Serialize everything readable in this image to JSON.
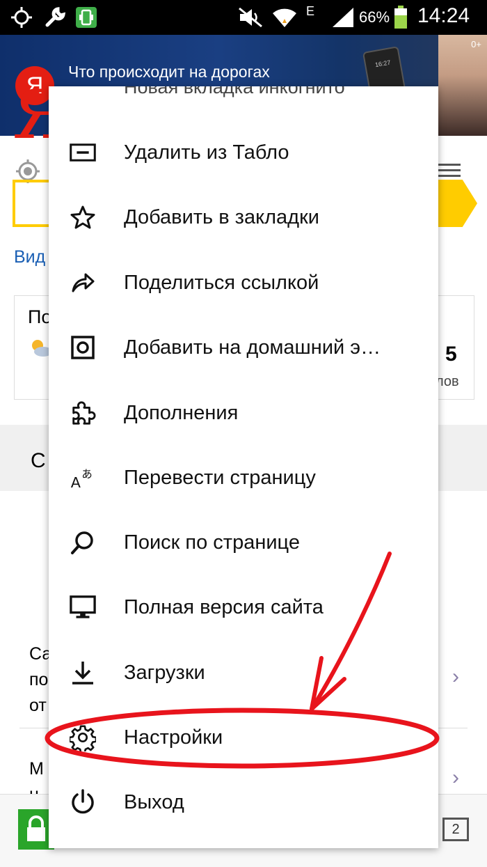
{
  "status_bar": {
    "battery": "66%",
    "time": "14:24",
    "network": "E"
  },
  "banner": {
    "logo": "Я",
    "headline": "Что происходит на дорогах",
    "phone_time": "16:27",
    "corner": "0+"
  },
  "background_page": {
    "logo": "Я",
    "link_fragment": "Вид",
    "weather_title_fragment": "По",
    "weather_value": "5",
    "weather_unit_fragment": "лов",
    "section_fragment": "С",
    "row1_lines": [
      "Са",
      "по",
      "от"
    ],
    "row2_lines": [
      "М",
      "н"
    ],
    "tab_count": "2"
  },
  "menu": {
    "top_partial": "Новая вкладка инкогнито",
    "items": [
      {
        "label": "Удалить из Табло",
        "icon": "remove-from-tablo-icon"
      },
      {
        "label": "Добавить в закладки",
        "icon": "star-icon"
      },
      {
        "label": "Поделиться ссылкой",
        "icon": "share-icon"
      },
      {
        "label": "Добавить на домашний экран",
        "icon": "home-screen-icon"
      },
      {
        "label": "Дополнения",
        "icon": "puzzle-icon"
      },
      {
        "label": "Перевести страницу",
        "icon": "translate-icon"
      },
      {
        "label": "Поиск по странице",
        "icon": "search-icon"
      },
      {
        "label": "Полная версия сайта",
        "icon": "desktop-icon"
      },
      {
        "label": "Загрузки",
        "icon": "download-icon"
      },
      {
        "label": "Настройки",
        "icon": "gear-icon"
      },
      {
        "label": "Выход",
        "icon": "power-icon"
      }
    ]
  },
  "colors": {
    "yandex_red": "#e41e13",
    "yandex_yellow": "#ffcc00",
    "annotation_red": "#e8141c",
    "banner_blue": "#1a3f82",
    "link_blue": "#1a5fb4"
  }
}
